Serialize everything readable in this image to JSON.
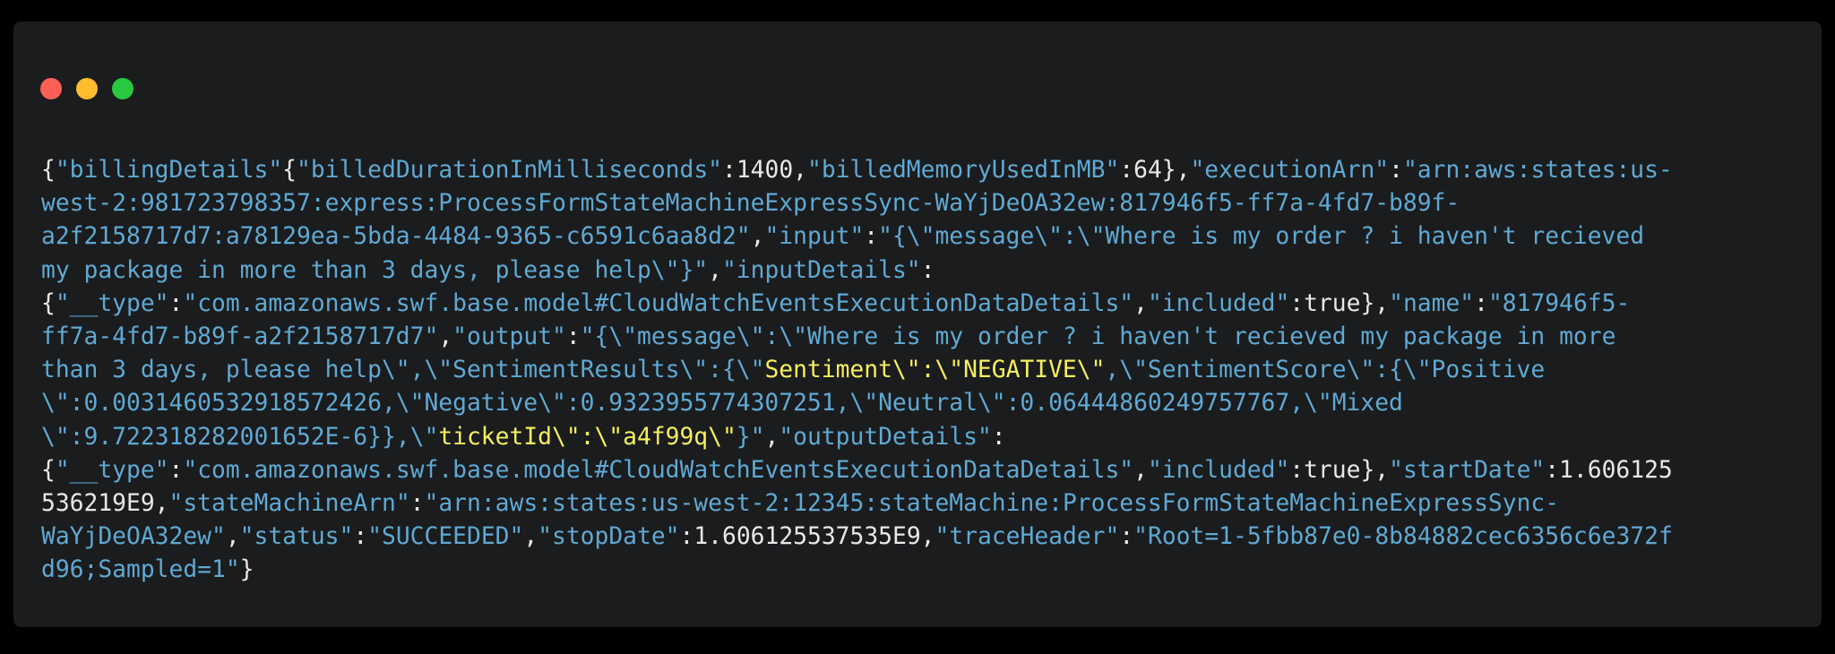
{
  "window": {
    "controls": [
      "close",
      "minimize",
      "maximize"
    ],
    "colors": {
      "background": "#1b1c1e",
      "close": "#ff5f57",
      "minimize": "#febc2e",
      "maximize": "#28c840",
      "key_and_string": "#5fa9d3",
      "punctuation_and_number": "#e8e8e8",
      "highlight": "#f6ef5e"
    }
  },
  "code": {
    "lines": [
      [
        {
          "t": "{",
          "c": "p"
        },
        {
          "t": "\"billingDetails\"",
          "c": "k"
        },
        {
          "t": "{",
          "c": "p"
        },
        {
          "t": "\"billedDurationInMilliseconds\"",
          "c": "k"
        },
        {
          "t": ":1400,",
          "c": "p"
        },
        {
          "t": "\"billedMemoryUsedInMB\"",
          "c": "k"
        },
        {
          "t": ":64},",
          "c": "p"
        },
        {
          "t": "\"executionArn\"",
          "c": "k"
        },
        {
          "t": ":",
          "c": "p"
        },
        {
          "t": "\"arn:aws:states:us-",
          "c": "s"
        }
      ],
      [
        {
          "t": "west-2:981723798357:express:ProcessFormStateMachineExpressSync-WaYjDeOA32ew:817946f5-ff7a-4fd7-b89f-",
          "c": "s"
        }
      ],
      [
        {
          "t": "a2f2158717d7:a78129ea-5bda-4484-9365-c6591c6aa8d2\"",
          "c": "s"
        },
        {
          "t": ",",
          "c": "p"
        },
        {
          "t": "\"input\"",
          "c": "k"
        },
        {
          "t": ":",
          "c": "p"
        },
        {
          "t": "\"{\\\"message\\\":\\\"Where is my order ? i haven't recieved",
          "c": "s"
        }
      ],
      [
        {
          "t": "my package in more than 3 days, please help\\\"}\"",
          "c": "s"
        },
        {
          "t": ",",
          "c": "p"
        },
        {
          "t": "\"inputDetails\"",
          "c": "k"
        },
        {
          "t": ":",
          "c": "p"
        }
      ],
      [
        {
          "t": "{",
          "c": "p"
        },
        {
          "t": "\"__type\"",
          "c": "k"
        },
        {
          "t": ":",
          "c": "p"
        },
        {
          "t": "\"com.amazonaws.swf.base.model#CloudWatchEventsExecutionDataDetails\"",
          "c": "s"
        },
        {
          "t": ",",
          "c": "p"
        },
        {
          "t": "\"included\"",
          "c": "k"
        },
        {
          "t": ":true},",
          "c": "p"
        },
        {
          "t": "\"name\"",
          "c": "k"
        },
        {
          "t": ":",
          "c": "p"
        },
        {
          "t": "\"817946f5-",
          "c": "s"
        }
      ],
      [
        {
          "t": "ff7a-4fd7-b89f-a2f2158717d7\"",
          "c": "s"
        },
        {
          "t": ",",
          "c": "p"
        },
        {
          "t": "\"output\"",
          "c": "k"
        },
        {
          "t": ":",
          "c": "p"
        },
        {
          "t": "\"{\\\"message\\\":\\\"Where is my order ? i haven't recieved my package in more",
          "c": "s"
        }
      ],
      [
        {
          "t": "than 3 days, please help\\\",\\\"SentimentResults\\\":{\\\"",
          "c": "s"
        },
        {
          "t": "Sentiment\\\":\\\"NEGATIVE\\\"",
          "c": "y"
        },
        {
          "t": ",\\\"SentimentScore\\\":{\\\"Positive",
          "c": "s"
        }
      ],
      [
        {
          "t": "\\\":0.0031460532918572426,\\\"Negative\\\":0.9323955774307251,\\\"Neutral\\\":0.06444860249757767,\\\"Mixed",
          "c": "s"
        }
      ],
      [
        {
          "t": "\\\":9.722318282001652E-6}},\\\"",
          "c": "s"
        },
        {
          "t": "ticketId\\\":\\\"a4f99q\\\"",
          "c": "y"
        },
        {
          "t": "}\"",
          "c": "s"
        },
        {
          "t": ",",
          "c": "p"
        },
        {
          "t": "\"outputDetails\"",
          "c": "k"
        },
        {
          "t": ":",
          "c": "p"
        }
      ],
      [
        {
          "t": "{",
          "c": "p"
        },
        {
          "t": "\"__type\"",
          "c": "k"
        },
        {
          "t": ":",
          "c": "p"
        },
        {
          "t": "\"com.amazonaws.swf.base.model#CloudWatchEventsExecutionDataDetails\"",
          "c": "s"
        },
        {
          "t": ",",
          "c": "p"
        },
        {
          "t": "\"included\"",
          "c": "k"
        },
        {
          "t": ":true},",
          "c": "p"
        },
        {
          "t": "\"startDate\"",
          "c": "k"
        },
        {
          "t": ":1.606125",
          "c": "p"
        }
      ],
      [
        {
          "t": "536219E9,",
          "c": "p"
        },
        {
          "t": "\"stateMachineArn\"",
          "c": "k"
        },
        {
          "t": ":",
          "c": "p"
        },
        {
          "t": "\"arn:aws:states:us-west-2:12345:stateMachine:ProcessFormStateMachineExpressSync-",
          "c": "s"
        }
      ],
      [
        {
          "t": "WaYjDeOA32ew\"",
          "c": "s"
        },
        {
          "t": ",",
          "c": "p"
        },
        {
          "t": "\"status\"",
          "c": "k"
        },
        {
          "t": ":",
          "c": "p"
        },
        {
          "t": "\"SUCCEEDED\"",
          "c": "s"
        },
        {
          "t": ",",
          "c": "p"
        },
        {
          "t": "\"stopDate\"",
          "c": "k"
        },
        {
          "t": ":1.606125537535E9,",
          "c": "p"
        },
        {
          "t": "\"traceHeader\"",
          "c": "k"
        },
        {
          "t": ":",
          "c": "p"
        },
        {
          "t": "\"Root=1-5fbb87e0-8b84882cec6356c6e372f",
          "c": "s"
        }
      ],
      [
        {
          "t": "d96;Sampled=1\"",
          "c": "s"
        },
        {
          "t": "}",
          "c": "p"
        }
      ]
    ]
  }
}
